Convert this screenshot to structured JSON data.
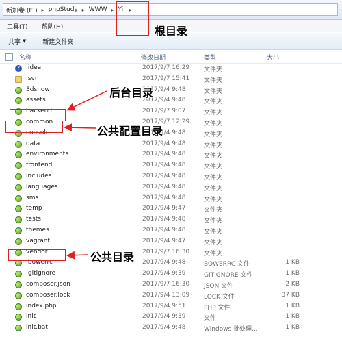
{
  "address": {
    "crumbs": [
      "新加卷 (E:)",
      "phpStudy",
      "WWW",
      "Yii"
    ]
  },
  "menu": {
    "items": [
      "工具(T)",
      "帮助(H)"
    ]
  },
  "toolbar": {
    "share": "共享",
    "new_folder": "新建文件夹"
  },
  "columns": {
    "name": "名称",
    "date": "修改日期",
    "type": "类型",
    "size": "大小"
  },
  "files": [
    {
      "name": ".idea",
      "date": "2017/9/7 16:29",
      "type": "文件夹",
      "size": "",
      "icon": "question"
    },
    {
      "name": ".svn",
      "date": "2017/9/7 15:41",
      "type": "文件夹",
      "size": "",
      "icon": "folder-plain"
    },
    {
      "name": "3dshow",
      "date": "2017/9/4 9:48",
      "type": "文件夹",
      "size": "",
      "icon": "folder"
    },
    {
      "name": "assets",
      "date": "2017/9/4 9:48",
      "type": "文件夹",
      "size": "",
      "icon": "folder"
    },
    {
      "name": "backend",
      "date": "2017/9/7 9:07",
      "type": "文件夹",
      "size": "",
      "icon": "folder"
    },
    {
      "name": "common",
      "date": "2017/9/7 12:29",
      "type": "文件夹",
      "size": "",
      "icon": "folder"
    },
    {
      "name": "console",
      "date": "2017/9/4 9:48",
      "type": "文件夹",
      "size": "",
      "icon": "folder"
    },
    {
      "name": "data",
      "date": "2017/9/4 9:48",
      "type": "文件夹",
      "size": "",
      "icon": "folder"
    },
    {
      "name": "environments",
      "date": "2017/9/4 9:48",
      "type": "文件夹",
      "size": "",
      "icon": "folder"
    },
    {
      "name": "frontend",
      "date": "2017/9/4 9:48",
      "type": "文件夹",
      "size": "",
      "icon": "folder"
    },
    {
      "name": "includes",
      "date": "2017/9/4 9:48",
      "type": "文件夹",
      "size": "",
      "icon": "folder"
    },
    {
      "name": "languages",
      "date": "2017/9/4 9:48",
      "type": "文件夹",
      "size": "",
      "icon": "folder"
    },
    {
      "name": "sms",
      "date": "2017/9/4 9:48",
      "type": "文件夹",
      "size": "",
      "icon": "folder"
    },
    {
      "name": "temp",
      "date": "2017/9/4 9:47",
      "type": "文件夹",
      "size": "",
      "icon": "folder"
    },
    {
      "name": "tests",
      "date": "2017/9/4 9:48",
      "type": "文件夹",
      "size": "",
      "icon": "folder"
    },
    {
      "name": "themes",
      "date": "2017/9/4 9:48",
      "type": "文件夹",
      "size": "",
      "icon": "folder"
    },
    {
      "name": "vagrant",
      "date": "2017/9/4 9:47",
      "type": "文件夹",
      "size": "",
      "icon": "folder"
    },
    {
      "name": "vendor",
      "date": "2017/9/7 16:30",
      "type": "文件夹",
      "size": "",
      "icon": "folder"
    },
    {
      "name": ".bowerrc",
      "date": "2017/9/4 9:48",
      "type": "BOWERRC 文件",
      "size": "1 KB",
      "icon": "file"
    },
    {
      "name": ".gitignore",
      "date": "2017/9/4 9:39",
      "type": "GITIGNORE 文件",
      "size": "1 KB",
      "icon": "file"
    },
    {
      "name": "composer.json",
      "date": "2017/9/7 16:30",
      "type": "JSON 文件",
      "size": "2 KB",
      "icon": "file"
    },
    {
      "name": "composer.lock",
      "date": "2017/9/4 13:09",
      "type": "LOCK 文件",
      "size": "37 KB",
      "icon": "file"
    },
    {
      "name": "index.php",
      "date": "2017/9/4 9:51",
      "type": "PHP 文件",
      "size": "1 KB",
      "icon": "file"
    },
    {
      "name": "init",
      "date": "2017/9/4 9:39",
      "type": "文件",
      "size": "1 KB",
      "icon": "file"
    },
    {
      "name": "init.bat",
      "date": "2017/9/4 9:48",
      "type": "Windows 批处理...",
      "size": "1 KB",
      "icon": "file"
    }
  ],
  "annotations": {
    "root": "根目录",
    "backend": "后台目录",
    "common": "公共配置目录",
    "vendor": "公共目录"
  },
  "colors": {
    "annotation": "#e02020"
  }
}
